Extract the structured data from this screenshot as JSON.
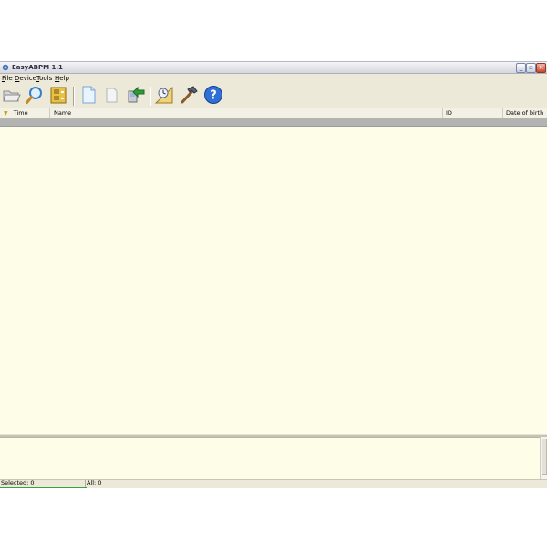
{
  "window": {
    "title": "EasyABPM 1.1"
  },
  "menu": [
    {
      "key": "F",
      "rest": "ile"
    },
    {
      "key": "D",
      "rest": "evice"
    },
    {
      "key": "T",
      "rest": "ools"
    },
    {
      "key": "H",
      "rest": "elp"
    }
  ],
  "toolbar": {
    "icons": [
      "open-folder-icon",
      "search-icon",
      "archive-icon",
      "new-document-icon",
      "blank-document-icon",
      "import-device-icon",
      "chart-settings-icon",
      "tools-hammer-icon",
      "help-icon"
    ]
  },
  "table": {
    "columns": [
      "Time",
      "Name",
      "ID",
      "Date of birth"
    ],
    "sort_indicator": "▼"
  },
  "status": {
    "selected": "Selected: 0",
    "all": "All: 0"
  },
  "colors": {
    "list_background": "#fefee8",
    "selected_row": "#b3b3b3",
    "help_blue": "#2f6fd6"
  }
}
